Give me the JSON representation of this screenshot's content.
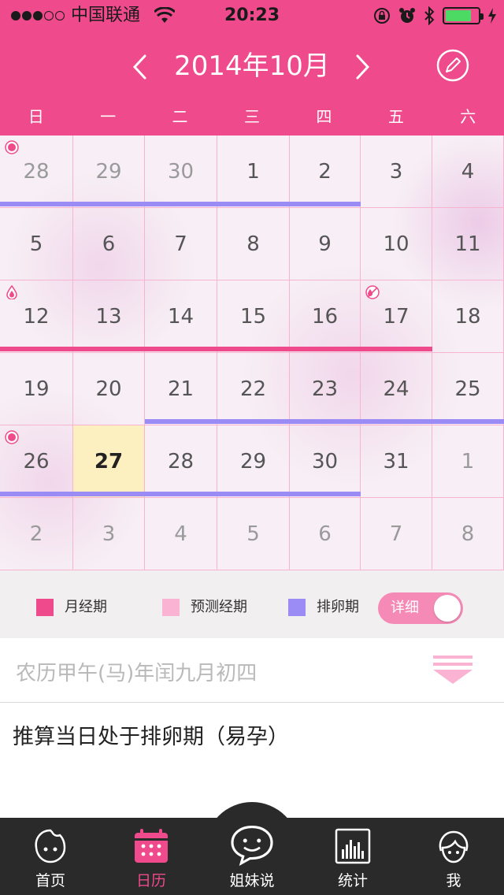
{
  "statusbar": {
    "carrier": "中国联通",
    "time": "20:23"
  },
  "header": {
    "month_title": "2014年10月"
  },
  "weekdays": [
    "日",
    "一",
    "二",
    "三",
    "四",
    "五",
    "六"
  ],
  "calendar": {
    "weeks": [
      [
        {
          "d": "28",
          "other": true
        },
        {
          "d": "29",
          "other": true
        },
        {
          "d": "30",
          "other": true
        },
        {
          "d": "1"
        },
        {
          "d": "2"
        },
        {
          "d": "3"
        },
        {
          "d": "4"
        }
      ],
      [
        {
          "d": "5"
        },
        {
          "d": "6"
        },
        {
          "d": "7"
        },
        {
          "d": "8"
        },
        {
          "d": "9"
        },
        {
          "d": "10"
        },
        {
          "d": "11"
        }
      ],
      [
        {
          "d": "12"
        },
        {
          "d": "13"
        },
        {
          "d": "14"
        },
        {
          "d": "15"
        },
        {
          "d": "16"
        },
        {
          "d": "17"
        },
        {
          "d": "18"
        }
      ],
      [
        {
          "d": "19"
        },
        {
          "d": "20"
        },
        {
          "d": "21"
        },
        {
          "d": "22"
        },
        {
          "d": "23"
        },
        {
          "d": "24"
        },
        {
          "d": "25"
        }
      ],
      [
        {
          "d": "26"
        },
        {
          "d": "27",
          "today": true
        },
        {
          "d": "28"
        },
        {
          "d": "29"
        },
        {
          "d": "30"
        },
        {
          "d": "31"
        },
        {
          "d": "1",
          "other": true
        }
      ],
      [
        {
          "d": "2",
          "other": true
        },
        {
          "d": "3",
          "other": true
        },
        {
          "d": "4",
          "other": true
        },
        {
          "d": "5",
          "other": true
        },
        {
          "d": "6",
          "other": true
        },
        {
          "d": "7",
          "other": true
        },
        {
          "d": "8",
          "other": true
        }
      ]
    ],
    "markers": [
      {
        "week": 0,
        "day": 0,
        "kind": "ovulation-day-icon"
      },
      {
        "week": 2,
        "day": 0,
        "kind": "period-start-icon"
      },
      {
        "week": 2,
        "day": 5,
        "kind": "period-end-icon"
      },
      {
        "week": 4,
        "day": 0,
        "kind": "ovulation-day-icon"
      }
    ],
    "bars": [
      {
        "week": 0,
        "from": 0,
        "to": 4,
        "kind": "ovulation"
      },
      {
        "week": 2,
        "from": 0,
        "to": 5,
        "kind": "period"
      },
      {
        "week": 3,
        "from": 2,
        "to": 6,
        "kind": "ovulation"
      },
      {
        "week": 4,
        "from": 0,
        "to": 4,
        "kind": "ovulation"
      }
    ]
  },
  "legend": {
    "period_label": "月经期",
    "predicted_label": "预测经期",
    "ovulation_label": "排卵期",
    "detail_label": "详细",
    "detail_on": true
  },
  "colors": {
    "brand": "#ef4a8c",
    "period": "#ef4a8c",
    "predicted": "#fbb3d4",
    "ovulation": "#9b8cf5",
    "today": "#fdf0c0",
    "toggle": "#f58ab6"
  },
  "info": {
    "lunar_date": "农历甲午(马)年闰九月初四",
    "note": "推算当日处于排卵期（易孕）"
  },
  "tabbar": {
    "items": [
      {
        "label": "首页",
        "icon": "home-face-icon"
      },
      {
        "label": "日历",
        "icon": "calendar-icon",
        "active": true
      },
      {
        "label": "姐妹说",
        "icon": "chat-bubble-icon"
      },
      {
        "label": "统计",
        "icon": "stats-icon"
      },
      {
        "label": "我",
        "icon": "profile-icon"
      }
    ]
  }
}
